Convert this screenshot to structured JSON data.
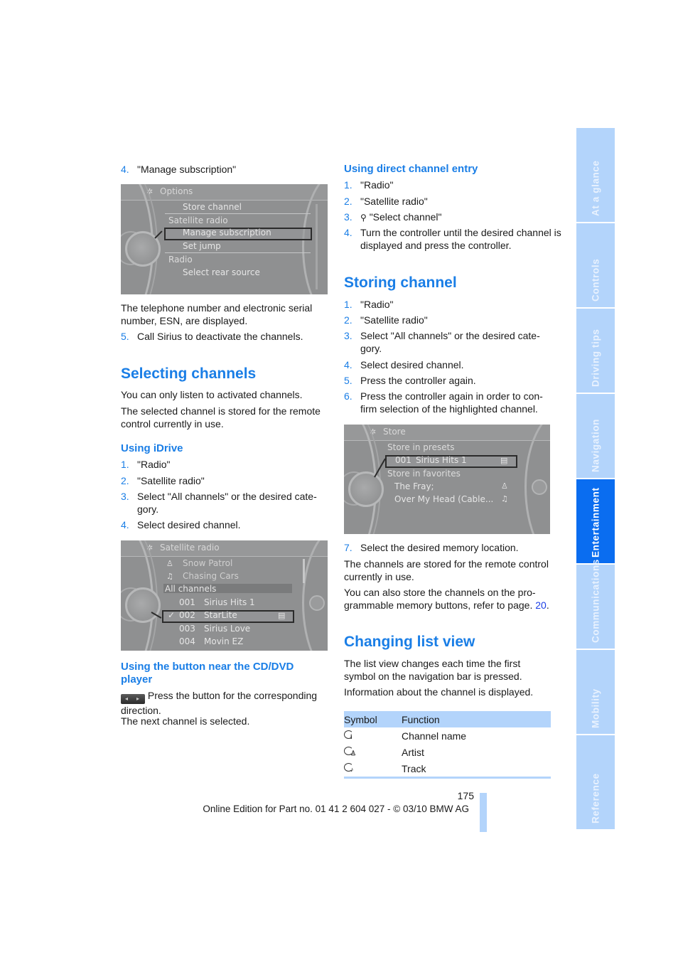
{
  "left_column": {
    "step4_top": {
      "num": "4.",
      "text": "\"Manage subscription\""
    },
    "options_screen": {
      "title": "Options",
      "items": [
        {
          "text": "Store channel",
          "type": "item"
        },
        {
          "text": "Satellite radio",
          "type": "category"
        },
        {
          "text": "Manage subscription",
          "type": "item",
          "selected": true
        },
        {
          "text": "Set jump",
          "type": "item"
        },
        {
          "text": "Radio",
          "type": "category"
        },
        {
          "text": "Select rear source",
          "type": "item"
        }
      ]
    },
    "esn_text": "The telephone number and electronic serial number, ESN, are displayed.",
    "step5": {
      "num": "5.",
      "text": "Call Sirius to deactivate the channels."
    },
    "selecting_channels": {
      "heading": "Selecting channels",
      "p1": "You can only listen to activated channels.",
      "p2": "The selected channel is stored for the remote control currently in use."
    },
    "using_idrive": {
      "heading": "Using iDrive",
      "steps": [
        {
          "num": "1.",
          "text": "\"Radio\""
        },
        {
          "num": "2.",
          "text": "\"Satellite radio\""
        },
        {
          "num": "3.",
          "text": "Select \"All channels\" or the desired cate-gory."
        },
        {
          "num": "4.",
          "text": "Select desired channel."
        }
      ]
    },
    "satellite_screen": {
      "title": "Satellite radio",
      "now_playing": [
        {
          "icon": "artist-icon",
          "text": "Snow Patrol"
        },
        {
          "icon": "music-note-icon",
          "text": "Chasing Cars"
        }
      ],
      "category": "All channels",
      "channels": [
        {
          "number": "001",
          "name": "Sirius Hits 1",
          "selected": false,
          "checked": false
        },
        {
          "number": "002",
          "name": "StarLite",
          "selected": true,
          "checked": true
        },
        {
          "number": "003",
          "name": "Sirius Love",
          "selected": false,
          "checked": false
        },
        {
          "number": "004",
          "name": "Movin EZ",
          "selected": false,
          "checked": false
        }
      ]
    },
    "cd_button": {
      "heading": "Using the button near the CD/DVD player",
      "text": "Press the button for the corresponding direction.",
      "result": "The next channel is selected."
    }
  },
  "right_column": {
    "direct_entry": {
      "heading": "Using direct channel entry",
      "steps": [
        {
          "num": "1.",
          "text": "\"Radio\""
        },
        {
          "num": "2.",
          "text": "\"Satellite radio\""
        },
        {
          "num": "3.",
          "text": "\"Select channel\"",
          "icon": "channel-search-icon"
        },
        {
          "num": "4.",
          "text": "Turn the controller until the desired channel is displayed and press the controller."
        }
      ]
    },
    "storing_channel": {
      "heading": "Storing channel",
      "steps": [
        {
          "num": "1.",
          "text": "\"Radio\""
        },
        {
          "num": "2.",
          "text": "\"Satellite radio\""
        },
        {
          "num": "3.",
          "text": "Select \"All channels\" or the desired cate-gory."
        },
        {
          "num": "4.",
          "text": "Select desired channel."
        },
        {
          "num": "5.",
          "text": "Press the controller again."
        },
        {
          "num": "6.",
          "text": "Press the controller again in order to con-firm selection of the highlighted channel."
        }
      ],
      "step7": {
        "num": "7.",
        "text": "Select the desired memory location."
      },
      "p1": "The channels are stored for the remote control currently in use.",
      "p2_prefix": "You can also store the channels on the pro-grammable memory buttons, refer to page. ",
      "p2_link": "20",
      "p2_suffix": "."
    },
    "store_screen": {
      "title": "Store",
      "presets_label": "Store in presets",
      "preset": {
        "number": "001",
        "name": "Sirius Hits 1",
        "selected": true
      },
      "favorites_label": "Store in favorites",
      "favorites": [
        {
          "text": "The Fray;",
          "icon": "artist-icon"
        },
        {
          "text": "Over My Head (Cable...",
          "icon": "music-note-icon"
        }
      ]
    },
    "list_view": {
      "heading": "Changing list view",
      "p1": "The list view changes each time the first symbol on the navigation bar is pressed.",
      "p2": "Information about the channel is displayed.",
      "table": {
        "headers": [
          "Symbol",
          "Function"
        ],
        "rows": [
          {
            "symbol": "channel-name-icon",
            "function": "Channel name"
          },
          {
            "symbol": "artist-view-icon",
            "function": "Artist"
          },
          {
            "symbol": "track-view-icon",
            "function": "Track"
          }
        ]
      }
    }
  },
  "footer": {
    "page_number": "175",
    "edition": "Online Edition for Part no. 01 41 2 604 027 - © 03/10 BMW AG"
  },
  "sidebar": {
    "tabs": [
      {
        "label": "At a glance",
        "active": false
      },
      {
        "label": "Controls",
        "active": false
      },
      {
        "label": "Driving tips",
        "active": false
      },
      {
        "label": "Navigation",
        "active": false
      },
      {
        "label": "Entertainment",
        "active": true
      },
      {
        "label": "Communications",
        "active": false
      },
      {
        "label": "Mobility",
        "active": false
      },
      {
        "label": "Reference",
        "active": false
      }
    ],
    "colors": {
      "inactive": "#b3d4fb",
      "active": "#0a6df0"
    }
  }
}
